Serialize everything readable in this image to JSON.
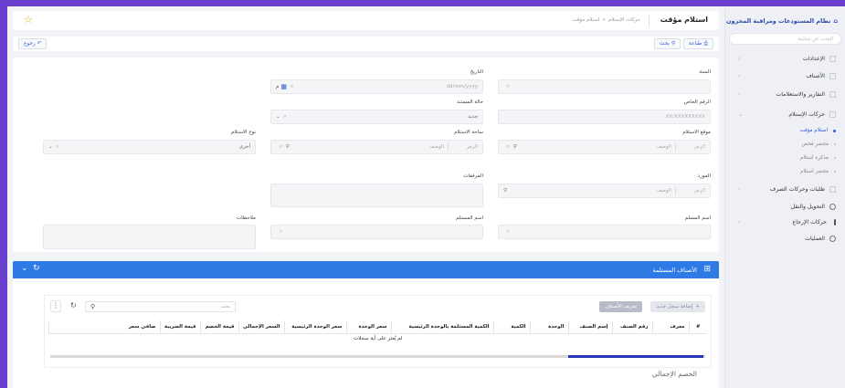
{
  "sidebar": {
    "app_title": "نظام المستودعات ومراقبة المخزون",
    "search_placeholder": "البحث عن شاشة",
    "items": [
      {
        "label": "الإعدادات"
      },
      {
        "label": "الأصناف"
      },
      {
        "label": "التقارير والاستعلامات"
      },
      {
        "label": "حركات الإستلام"
      }
    ],
    "subitems": [
      {
        "label": "استلام مؤقت"
      },
      {
        "label": "محضر فحص"
      },
      {
        "label": "مذكرة استلام"
      },
      {
        "label": "محضر استلام"
      }
    ],
    "items2": [
      {
        "label": "طلبات وحركات الصرف"
      },
      {
        "label": "التحويل والنقل"
      },
      {
        "label": "حركات الإرجاع"
      },
      {
        "label": "العمليات"
      }
    ]
  },
  "header": {
    "title": "استلام مؤقت",
    "breadcrumb_1": "حركات الإستلام",
    "breadcrumb_sep": "»",
    "breadcrumb_2": "استلام مؤقت"
  },
  "toolbar": {
    "print_label": "طباعة",
    "search_label": "بحث",
    "back_label": "رجوع"
  },
  "form": {
    "year": {
      "label": "السنة",
      "value": "×"
    },
    "date": {
      "label": "التاريخ",
      "placeholder": "dd/mm/yyyy",
      "clear": "×",
      "suffix": "م"
    },
    "private_no": {
      "label": "الرقم الخاص",
      "value": "XX/XXXXXXXXX"
    },
    "doc_status": {
      "label": "حالة المستند",
      "value": "جديد"
    },
    "receipt_location": {
      "label": "موقع الاستلام",
      "code": "الرمز",
      "desc": "الوصف"
    },
    "receipt_area": {
      "label": "ساحة الاستلام",
      "code": "الرمز",
      "desc": "الوصف"
    },
    "receipt_type": {
      "label": "نوع الاستلام",
      "value": "أخرى"
    },
    "supplier": {
      "label": "المورد",
      "code": "الرمز",
      "desc": "الوصف"
    },
    "attachments": {
      "label": "المرفقات"
    },
    "deliverer": {
      "label": "اسم المسلم",
      "value": "×"
    },
    "receiver": {
      "label": "اسم المستلم",
      "value": "×"
    },
    "notes": {
      "label": "ملاحظات"
    }
  },
  "items_panel": {
    "title": "الأصناف المستلمة",
    "add_button": "إضافة سجل جديد",
    "define_button": "تعريف الأصناف",
    "search_placeholder": "بحث",
    "columns": [
      "#",
      "معرف",
      "رقم الصنف",
      "إسم الصنف",
      "الوحدة",
      "الكمية",
      "الكمية المستلمة بالوحدة الرئيسية",
      "سعر الوحدة",
      "سعر الوحدة الرئيسية",
      "السعر الإجمالي",
      "قيمة الخصم",
      "قيمة الضريبة",
      "صافي سعر"
    ],
    "empty_text": "لم يُعثر على أية سجلات",
    "total_discount_label": "الخصم الإجمالي"
  },
  "colors": {
    "accent": "#2f7be6",
    "frame": "#6a3fd0",
    "star": "#e6a817"
  }
}
